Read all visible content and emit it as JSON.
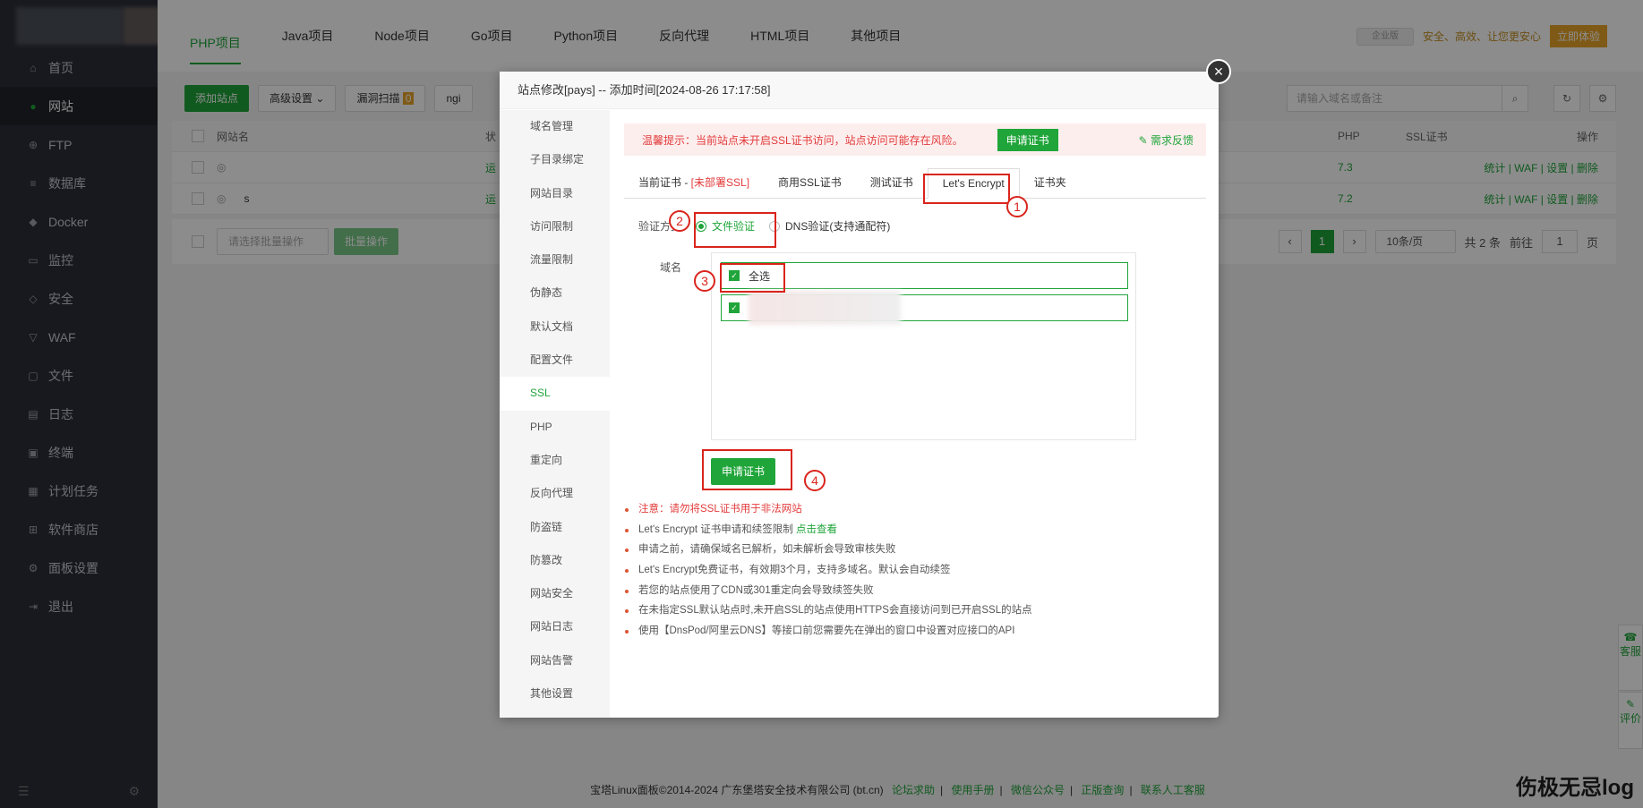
{
  "sidebar": {
    "items": [
      {
        "label": "首页",
        "icon": "home-icon"
      },
      {
        "label": "网站",
        "icon": "globe-icon"
      },
      {
        "label": "FTP",
        "icon": "ftp-icon"
      },
      {
        "label": "数据库",
        "icon": "database-icon"
      },
      {
        "label": "Docker",
        "icon": "docker-icon"
      },
      {
        "label": "监控",
        "icon": "monitor-icon"
      },
      {
        "label": "安全",
        "icon": "shield-icon"
      },
      {
        "label": "WAF",
        "icon": "waf-icon"
      },
      {
        "label": "文件",
        "icon": "folder-icon"
      },
      {
        "label": "日志",
        "icon": "log-icon"
      },
      {
        "label": "终端",
        "icon": "terminal-icon"
      },
      {
        "label": "计划任务",
        "icon": "calendar-icon"
      },
      {
        "label": "软件商店",
        "icon": "store-icon"
      },
      {
        "label": "面板设置",
        "icon": "gear-icon"
      },
      {
        "label": "退出",
        "icon": "logout-icon"
      }
    ]
  },
  "topbar": {
    "tabs": [
      "PHP项目",
      "Java项目",
      "Node项目",
      "Go项目",
      "Python项目",
      "反向代理",
      "HTML项目",
      "其他项目"
    ],
    "pill": "企业版",
    "slogan": "安全、高效、让您更安心",
    "exp_button": "立即体验"
  },
  "toolbar": {
    "add_site": "添加站点",
    "advanced": "高级设置",
    "scan": "漏洞扫描",
    "scan_count": "0",
    "nginx": "ngi",
    "search_placeholder": "请输入域名或备注"
  },
  "table": {
    "headers": {
      "name": "网站名",
      "state": "状",
      "php": "PHP",
      "ssl": "SSL证书",
      "op": "操作"
    },
    "rows": [
      {
        "state": "运",
        "php": "7.3",
        "name_suffix": "",
        "ops": "统计 | WAF | 设置 | 删除"
      },
      {
        "state": "运",
        "php": "7.2",
        "name_suffix": "s",
        "ops": "统计 | WAF | 设置 | 删除"
      }
    ],
    "batch_placeholder": "请选择批量操作",
    "batch_btn": "批量操作"
  },
  "pager": {
    "current": "1",
    "per_page": "10条/页",
    "total": "共 2 条",
    "goto": "前往",
    "goto_val": "1",
    "page_unit": "页"
  },
  "footer": {
    "copyright": "宝塔Linux面板©2014-2024 广东堡塔安全技术有限公司 (bt.cn)",
    "links": [
      "论坛求助",
      "使用手册",
      "微信公众号",
      "正版查询",
      "联系人工客服"
    ]
  },
  "float": {
    "service": "客服",
    "review": "评价"
  },
  "modal": {
    "title": "站点修改[pays] -- 添加时间[2024-08-26 17:17:58]",
    "side": [
      "域名管理",
      "子目录绑定",
      "网站目录",
      "访问限制",
      "流量限制",
      "伪静态",
      "默认文档",
      "配置文件",
      "SSL",
      "PHP",
      "重定向",
      "反向代理",
      "防盗链",
      "防篡改",
      "网站安全",
      "网站日志",
      "网站告警",
      "其他设置"
    ],
    "warn_text": "温馨提示：当前站点未开启SSL证书访问，站点访问可能存在风险。",
    "warn_apply": "申请证书",
    "feedback": "需求反馈",
    "ssl_tabs": {
      "current_prefix": "当前证书 - ",
      "current_status": "[未部署SSL]",
      "commercial": "商用SSL证书",
      "test": "测试证书",
      "lets": "Let's Encrypt",
      "folder": "证书夹"
    },
    "verify_label": "验证方式",
    "verify_file": "文件验证",
    "verify_dns": "DNS验证(支持通配符)",
    "domain_label": "域名",
    "select_all": "全选",
    "apply_btn": "申请证书",
    "notes": [
      "注意：请勿将SSL证书用于非法网站",
      "Let's Encrypt 证书申请和续签限制 ",
      "申请之前，请确保域名已解析，如未解析会导致审核失败",
      "Let's Encrypt免费证书，有效期3个月，支持多域名。默认会自动续签",
      "若您的站点使用了CDN或301重定向会导致续签失败",
      "在未指定SSL默认站点时,未开启SSL的站点使用HTTPS会直接访问到已开启SSL的站点",
      "使用【DnsPod/阿里云DNS】等接口前您需要先在弹出的窗口中设置对应接口的API"
    ],
    "note_link": "点击查看"
  },
  "annotations": [
    "1",
    "2",
    "3",
    "4"
  ],
  "watermark": "伤极无忌log",
  "colors": {
    "accent": "#20a53a",
    "warn": "#e23b3b",
    "annotation": "#d9241c"
  }
}
